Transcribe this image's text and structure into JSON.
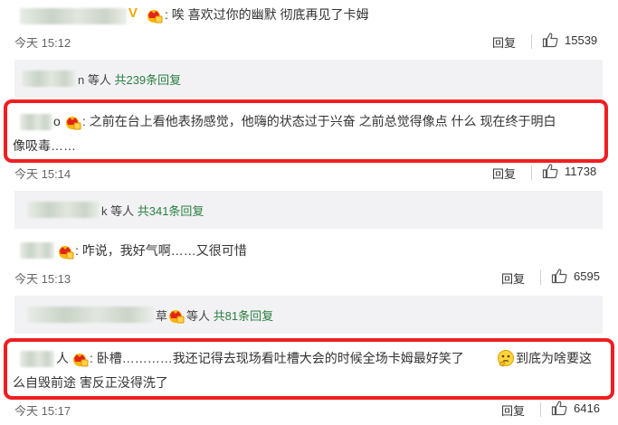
{
  "comments": [
    {
      "text": ": 唉 喜欢过你的幽默 彻底再见了卡姆",
      "time": "今天 15:12",
      "reply_label": "回复",
      "likes": "15539",
      "replies": {
        "name_tail": "n",
        "suffix": " 等人 ",
        "count_text": "共239条回复"
      }
    },
    {
      "name_tail": "o",
      "text_line1": ": 之前在台上看他表扬感觉，他嗨的状态过于兴奋 之前总觉得像点 什么 现在终于明白",
      "text_line2": "像吸毒……",
      "time": "今天 15:14",
      "reply_label": "回复",
      "likes": "11738",
      "replies": {
        "name_tail": "k",
        "suffix": " 等人 ",
        "count_text": "共341条回复"
      }
    },
    {
      "text": ": 咋说，我好气啊……又很可惜",
      "time": "今天 15:13",
      "reply_label": "回复",
      "likes": "6595",
      "replies": {
        "name_tail": "草",
        "suffix": " 等人 ",
        "count_text": "共81条回复"
      }
    },
    {
      "name_tail": "人",
      "text_line1_a": ": 卧槽…………我还记得去现场看吐槽大会的时候全场卡姆最好笑了",
      "text_line1_b": "到底为啥要这",
      "text_line2": "么自毁前途 害反正没得洗了",
      "time": "今天 15:17",
      "reply_label": "回复",
      "likes": "6416"
    }
  ],
  "colors": {
    "highlight": "#ee1f22",
    "reply_count": "#2a7f3f",
    "sub_bg": "#f2f2f5"
  },
  "icons": [
    "crown-badge-icon",
    "thumbs-up-icon",
    "emoji-thinking-icon"
  ]
}
